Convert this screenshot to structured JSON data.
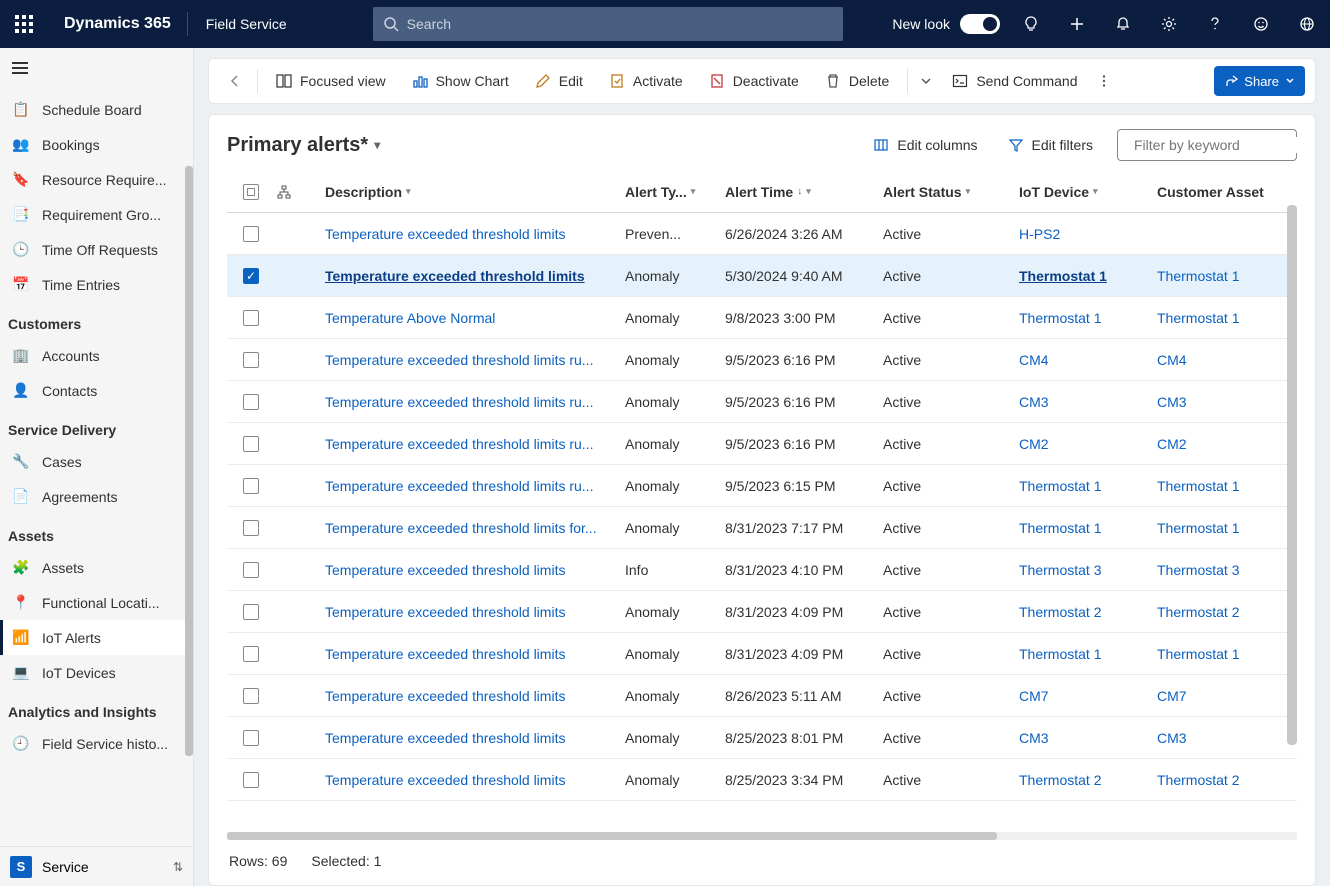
{
  "topbar": {
    "brand": "Dynamics 365",
    "app": "Field Service",
    "search_placeholder": "Search",
    "newlook_label": "New look"
  },
  "sidebar": {
    "items_top": [
      {
        "icon": "📋",
        "label": "Schedule Board"
      },
      {
        "icon": "👥",
        "label": "Bookings"
      },
      {
        "icon": "🔖",
        "label": "Resource Require..."
      },
      {
        "icon": "📑",
        "label": "Requirement Gro..."
      },
      {
        "icon": "🕒",
        "label": "Time Off Requests"
      },
      {
        "icon": "📅",
        "label": "Time Entries"
      }
    ],
    "section_customers": "Customers",
    "items_customers": [
      {
        "icon": "🏢",
        "label": "Accounts"
      },
      {
        "icon": "👤",
        "label": "Contacts"
      }
    ],
    "section_service": "Service Delivery",
    "items_service": [
      {
        "icon": "🔧",
        "label": "Cases"
      },
      {
        "icon": "📄",
        "label": "Agreements"
      }
    ],
    "section_assets": "Assets",
    "items_assets": [
      {
        "icon": "🧩",
        "label": "Assets"
      },
      {
        "icon": "📍",
        "label": "Functional Locati..."
      },
      {
        "icon": "📶",
        "label": "IoT Alerts",
        "active": true
      },
      {
        "icon": "💻",
        "label": "IoT Devices"
      }
    ],
    "section_analytics": "Analytics and Insights",
    "items_analytics": [
      {
        "icon": "🕘",
        "label": "Field Service histo..."
      }
    ],
    "area_badge": "S",
    "area_label": "Service"
  },
  "cmdbar": {
    "back": "Back",
    "focused": "Focused view",
    "showchart": "Show Chart",
    "edit": "Edit",
    "activate": "Activate",
    "deactivate": "Deactivate",
    "delete": "Delete",
    "sendcmd": "Send Command",
    "share": "Share"
  },
  "list": {
    "title": "Primary alerts*",
    "edit_columns": "Edit columns",
    "edit_filters": "Edit filters",
    "filter_placeholder": "Filter by keyword",
    "columns": {
      "desc": "Description",
      "atype": "Alert Ty...",
      "atime": "Alert Time",
      "astatus": "Alert Status",
      "iot": "IoT Device",
      "asset": "Customer Asset"
    },
    "rows": [
      {
        "sel": false,
        "desc": "Temperature exceeded threshold limits",
        "atype": "Preven...",
        "atime": "6/26/2024 3:26 AM",
        "astatus": "Active",
        "iot": "H-PS2",
        "asset": ""
      },
      {
        "sel": true,
        "desc": "Temperature exceeded threshold limits",
        "atype": "Anomaly",
        "atime": "5/30/2024 9:40 AM",
        "astatus": "Active",
        "iot": "Thermostat 1",
        "asset": "Thermostat 1"
      },
      {
        "sel": false,
        "desc": "Temperature Above Normal",
        "atype": "Anomaly",
        "atime": "9/8/2023 3:00 PM",
        "astatus": "Active",
        "iot": "Thermostat 1",
        "asset": "Thermostat 1"
      },
      {
        "sel": false,
        "desc": "Temperature exceeded threshold limits ru...",
        "atype": "Anomaly",
        "atime": "9/5/2023 6:16 PM",
        "astatus": "Active",
        "iot": "CM4",
        "asset": "CM4"
      },
      {
        "sel": false,
        "desc": "Temperature exceeded threshold limits ru...",
        "atype": "Anomaly",
        "atime": "9/5/2023 6:16 PM",
        "astatus": "Active",
        "iot": "CM3",
        "asset": "CM3"
      },
      {
        "sel": false,
        "desc": "Temperature exceeded threshold limits ru...",
        "atype": "Anomaly",
        "atime": "9/5/2023 6:16 PM",
        "astatus": "Active",
        "iot": "CM2",
        "asset": "CM2"
      },
      {
        "sel": false,
        "desc": "Temperature exceeded threshold limits ru...",
        "atype": "Anomaly",
        "atime": "9/5/2023 6:15 PM",
        "astatus": "Active",
        "iot": "Thermostat 1",
        "asset": "Thermostat 1"
      },
      {
        "sel": false,
        "desc": "Temperature exceeded threshold limits for...",
        "atype": "Anomaly",
        "atime": "8/31/2023 7:17 PM",
        "astatus": "Active",
        "iot": "Thermostat 1",
        "asset": "Thermostat 1"
      },
      {
        "sel": false,
        "desc": "Temperature exceeded threshold limits",
        "atype": "Info",
        "atime": "8/31/2023 4:10 PM",
        "astatus": "Active",
        "iot": "Thermostat 3",
        "asset": "Thermostat 3"
      },
      {
        "sel": false,
        "desc": "Temperature exceeded threshold limits",
        "atype": "Anomaly",
        "atime": "8/31/2023 4:09 PM",
        "astatus": "Active",
        "iot": "Thermostat 2",
        "asset": "Thermostat 2"
      },
      {
        "sel": false,
        "desc": "Temperature exceeded threshold limits",
        "atype": "Anomaly",
        "atime": "8/31/2023 4:09 PM",
        "astatus": "Active",
        "iot": "Thermostat 1",
        "asset": "Thermostat 1"
      },
      {
        "sel": false,
        "desc": "Temperature exceeded threshold limits",
        "atype": "Anomaly",
        "atime": "8/26/2023 5:11 AM",
        "astatus": "Active",
        "iot": "CM7",
        "asset": "CM7"
      },
      {
        "sel": false,
        "desc": "Temperature exceeded threshold limits",
        "atype": "Anomaly",
        "atime": "8/25/2023 8:01 PM",
        "astatus": "Active",
        "iot": "CM3",
        "asset": "CM3"
      },
      {
        "sel": false,
        "desc": "Temperature exceeded threshold limits",
        "atype": "Anomaly",
        "atime": "8/25/2023 3:34 PM",
        "astatus": "Active",
        "iot": "Thermostat 2",
        "asset": "Thermostat 2"
      }
    ],
    "footer_rows": "Rows: 69",
    "footer_selected": "Selected: 1"
  }
}
